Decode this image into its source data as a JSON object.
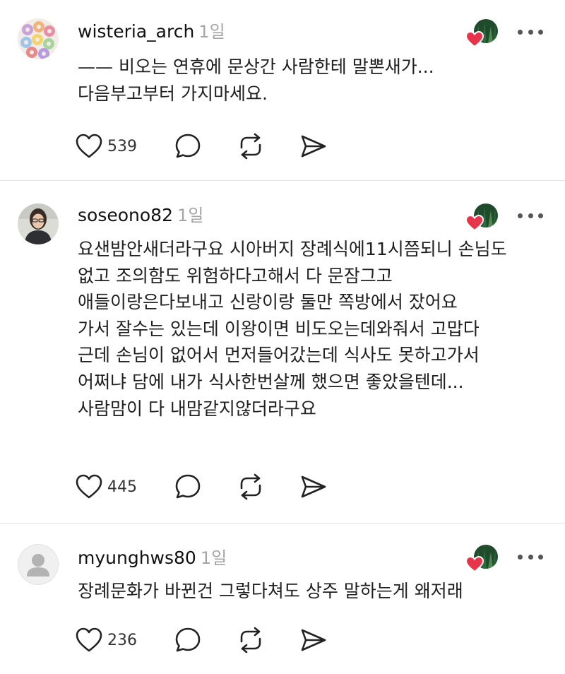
{
  "comments": [
    {
      "username": "wisteria_arch",
      "time": "1일",
      "lines": [
        "—— 비오는 연휴에 문상간 사람한테 말뽄새가...",
        "다음부고부터 가지마세요."
      ],
      "likes": "539"
    },
    {
      "username": "soseono82",
      "time": "1일",
      "lines": [
        "요샌밤안새더라구요 시아버지 장례식에11시쯤되니 손님도",
        "없고 조의함도 위험하다고해서 다 문잠그고",
        "애들이랑은다보내고 신랑이랑 둘만 쪽방에서 잤어요",
        "가서 잘수는 있는데 이왕이면 비도오는데와줘서 고맙다",
        "근데 손님이 없어서 먼저들어갔는데 식사도 못하고가서",
        "어쩌냐 담에 내가 식사한번살께 했으면 좋았을텐데...",
        "사람맘이 다 내맘같지않더라구요"
      ],
      "likes": "445"
    },
    {
      "username": "myunghws80",
      "time": "1일",
      "lines": [
        "장례문화가 바뀐건 그렇다쳐도 상주 말하는게 왜저래"
      ],
      "likes": "236"
    }
  ],
  "icons": {
    "like": "heart-icon",
    "reply": "comment-bubble-icon",
    "repost": "repost-icon",
    "share": "send-icon",
    "more": "more-dots-icon"
  },
  "colors": {
    "heart_badge": "#e8344a",
    "time": "#a5a5a5",
    "icon": "#222222",
    "divider": "#e4e4e4"
  }
}
